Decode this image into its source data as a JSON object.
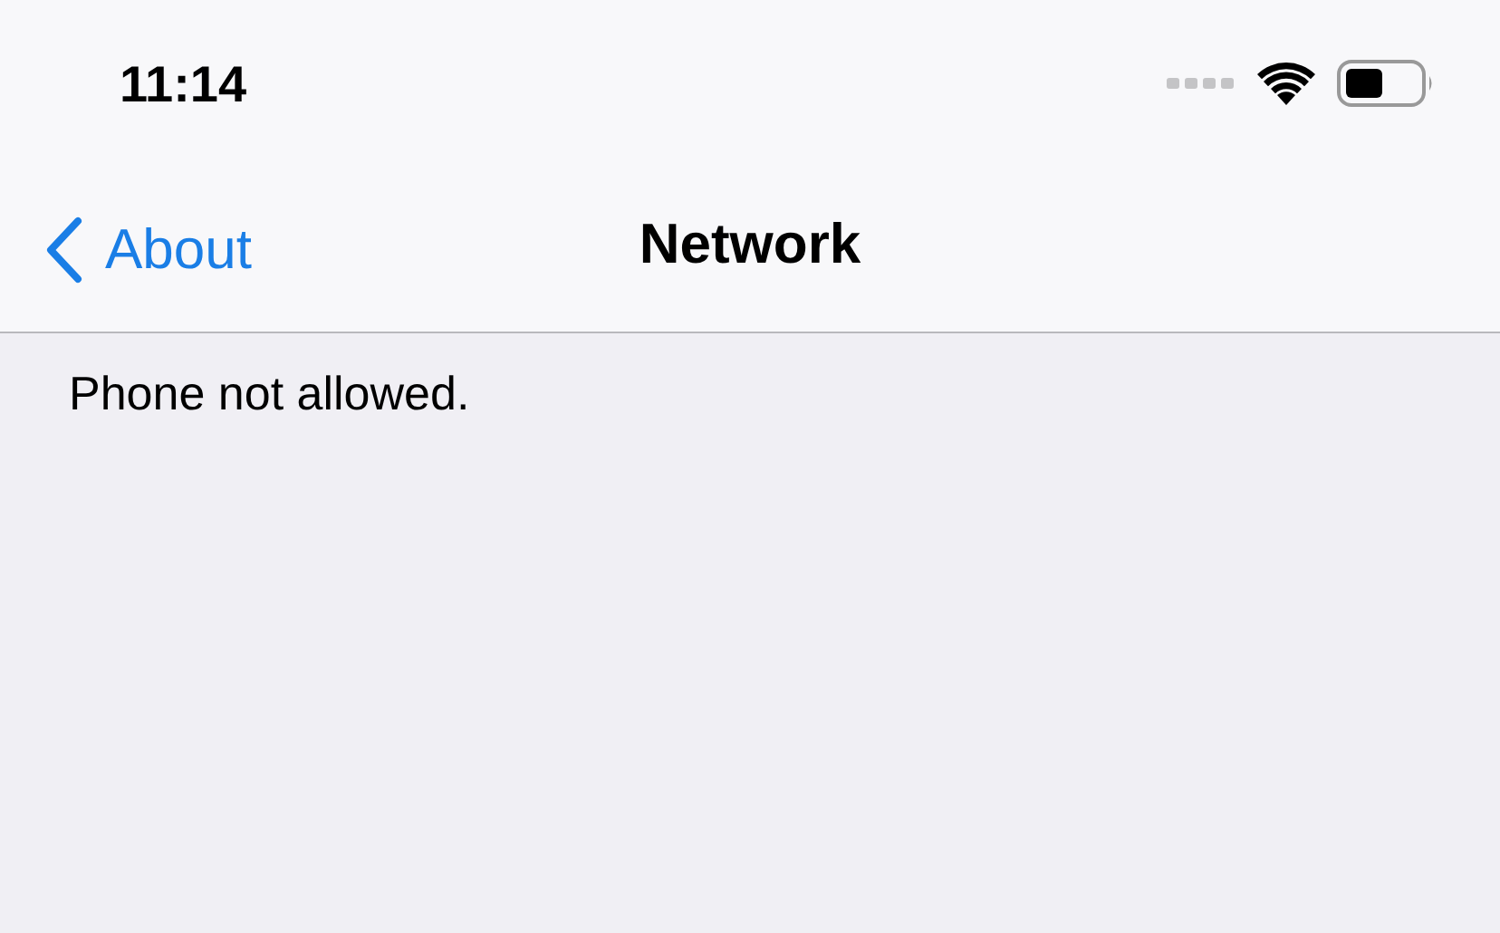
{
  "status_bar": {
    "time": "11:14"
  },
  "nav_bar": {
    "back": "About",
    "title": "Network"
  },
  "message": "Phone not allowed."
}
